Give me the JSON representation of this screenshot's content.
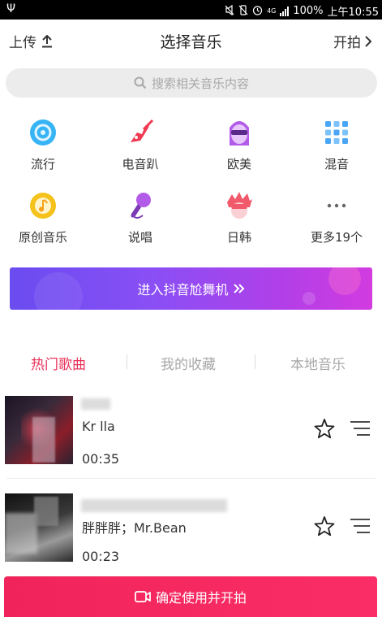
{
  "status_bar": {
    "network": "4G",
    "battery": "100%",
    "time": "上午10:55"
  },
  "header": {
    "upload_label": "上传",
    "title": "选择音乐",
    "shoot_label": "开拍"
  },
  "search": {
    "placeholder": "搜索相关音乐内容"
  },
  "categories": [
    {
      "label": "流行",
      "icon": "disc-icon",
      "color": "#36b4f5"
    },
    {
      "label": "电音趴",
      "icon": "guitar-icon",
      "color": "#f03a52"
    },
    {
      "label": "欧美",
      "icon": "face-sunglasses-icon",
      "color": "#b25be8"
    },
    {
      "label": "混音",
      "icon": "grid-dots-icon",
      "color": "#4aa6f5"
    },
    {
      "label": "原创音乐",
      "icon": "music-note-icon",
      "color": "#f5c21b"
    },
    {
      "label": "说唱",
      "icon": "microphone-icon",
      "color": "#b25be8"
    },
    {
      "label": "日韩",
      "icon": "spiky-hair-icon",
      "color": "#f05a6a"
    },
    {
      "label": "更多19个",
      "icon": "more-icon",
      "color": "#666666"
    }
  ],
  "banner": {
    "label": "进入抖音尬舞机"
  },
  "tabs": [
    {
      "label": "热门歌曲",
      "active": true
    },
    {
      "label": "我的收藏",
      "active": false
    },
    {
      "label": "本地音乐",
      "active": false
    }
  ],
  "songs": [
    {
      "title": "Kr      lla",
      "duration": "00:35"
    },
    {
      "title": "胖胖胖；Mr.Bean",
      "duration": "00:23"
    }
  ],
  "confirm_button": {
    "label": "确定使用并开拍"
  },
  "colors": {
    "accent": "#e8325a",
    "confirm": "#f0245a",
    "banner_start": "#6a4cf0",
    "banner_end": "#d23be0"
  }
}
